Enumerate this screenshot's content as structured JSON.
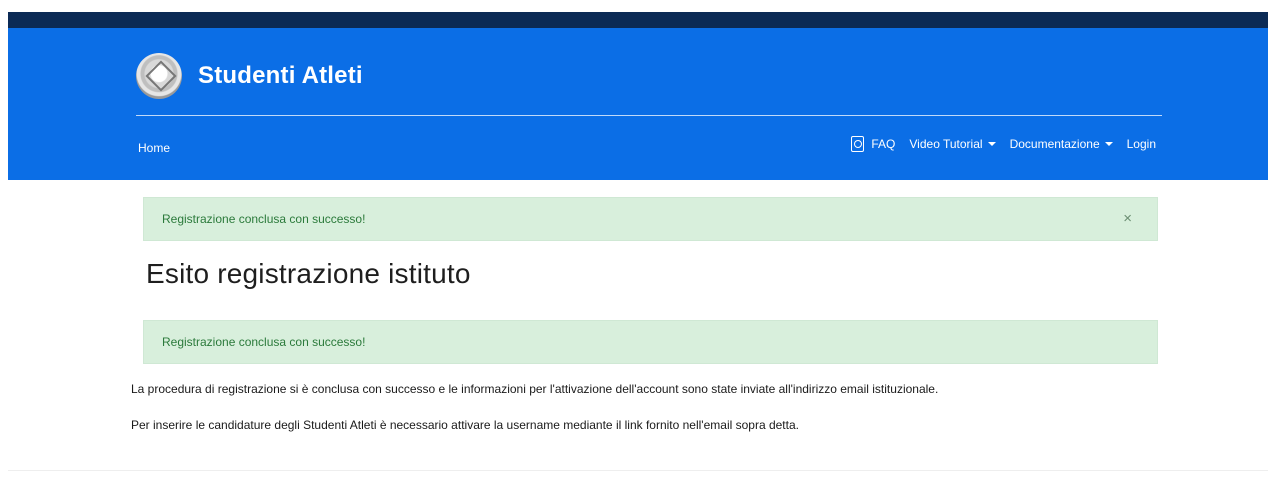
{
  "header": {
    "brand_title": "Studenti Atleti",
    "nav_left": "Home",
    "nav_right": [
      {
        "label": "FAQ",
        "icon": "pdf-icon"
      },
      {
        "label": "Video Tutorial",
        "icon": "caret-down-icon"
      },
      {
        "label": "Documentazione",
        "icon": "caret-down-icon"
      },
      {
        "label": "Login"
      }
    ],
    "colors": {
      "header_bg": "#0b6ee6",
      "top_strip": "#0b2a55"
    }
  },
  "alerts": {
    "top": {
      "text": "Registrazione conclusa con successo!",
      "close": "×"
    },
    "mid": {
      "text": "Registrazione conclusa con successo!"
    },
    "colors": {
      "bg": "#d8efdc",
      "text": "#2b7a3b"
    }
  },
  "page": {
    "title": "Esito registrazione istituto",
    "paragraphs": [
      "La procedura di registrazione si è conclusa con successo e le informazioni per l'attivazione dell'account sono state inviate all'indirizzo email istituzionale.",
      "Per inserire le candidature degli Studenti Atleti è necessario attivare la username mediante il link fornito nell'email sopra detta."
    ]
  }
}
